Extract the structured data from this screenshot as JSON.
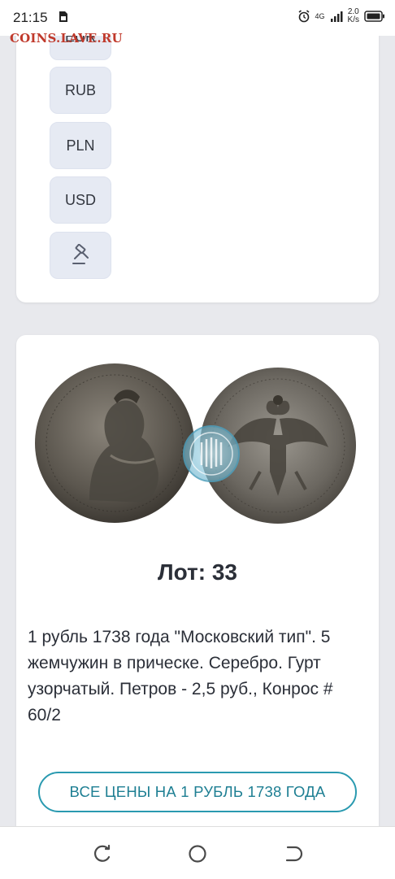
{
  "status_bar": {
    "time": "21:15",
    "network": "4G",
    "speed_value": "2.0",
    "speed_unit": "K/s"
  },
  "watermark": "COINS.LAVE.RU",
  "currency_buttons": [
    {
      "label": "EUR"
    },
    {
      "label": "RUB"
    },
    {
      "label": "PLN"
    },
    {
      "label": "USD"
    },
    {
      "icon": "auction-gavel-icon"
    }
  ],
  "lot": {
    "title": "Лот: 33",
    "description": "1 рубль 1738 года \"Московский тип\". 5 жемчужин в прическе. Серебро. Гурт узорчатый. Петров - 2,5 руб., Конрос # 60/2",
    "all_prices_label": "ВСЕ ЦЕНЫ НА 1 РУБЛЬ 1738 ГОДА"
  },
  "colors": {
    "accent": "#2a9ab0",
    "button_bg": "#e6eaf3",
    "page_bg": "#e8e9ed",
    "watermark": "#c0392b"
  }
}
